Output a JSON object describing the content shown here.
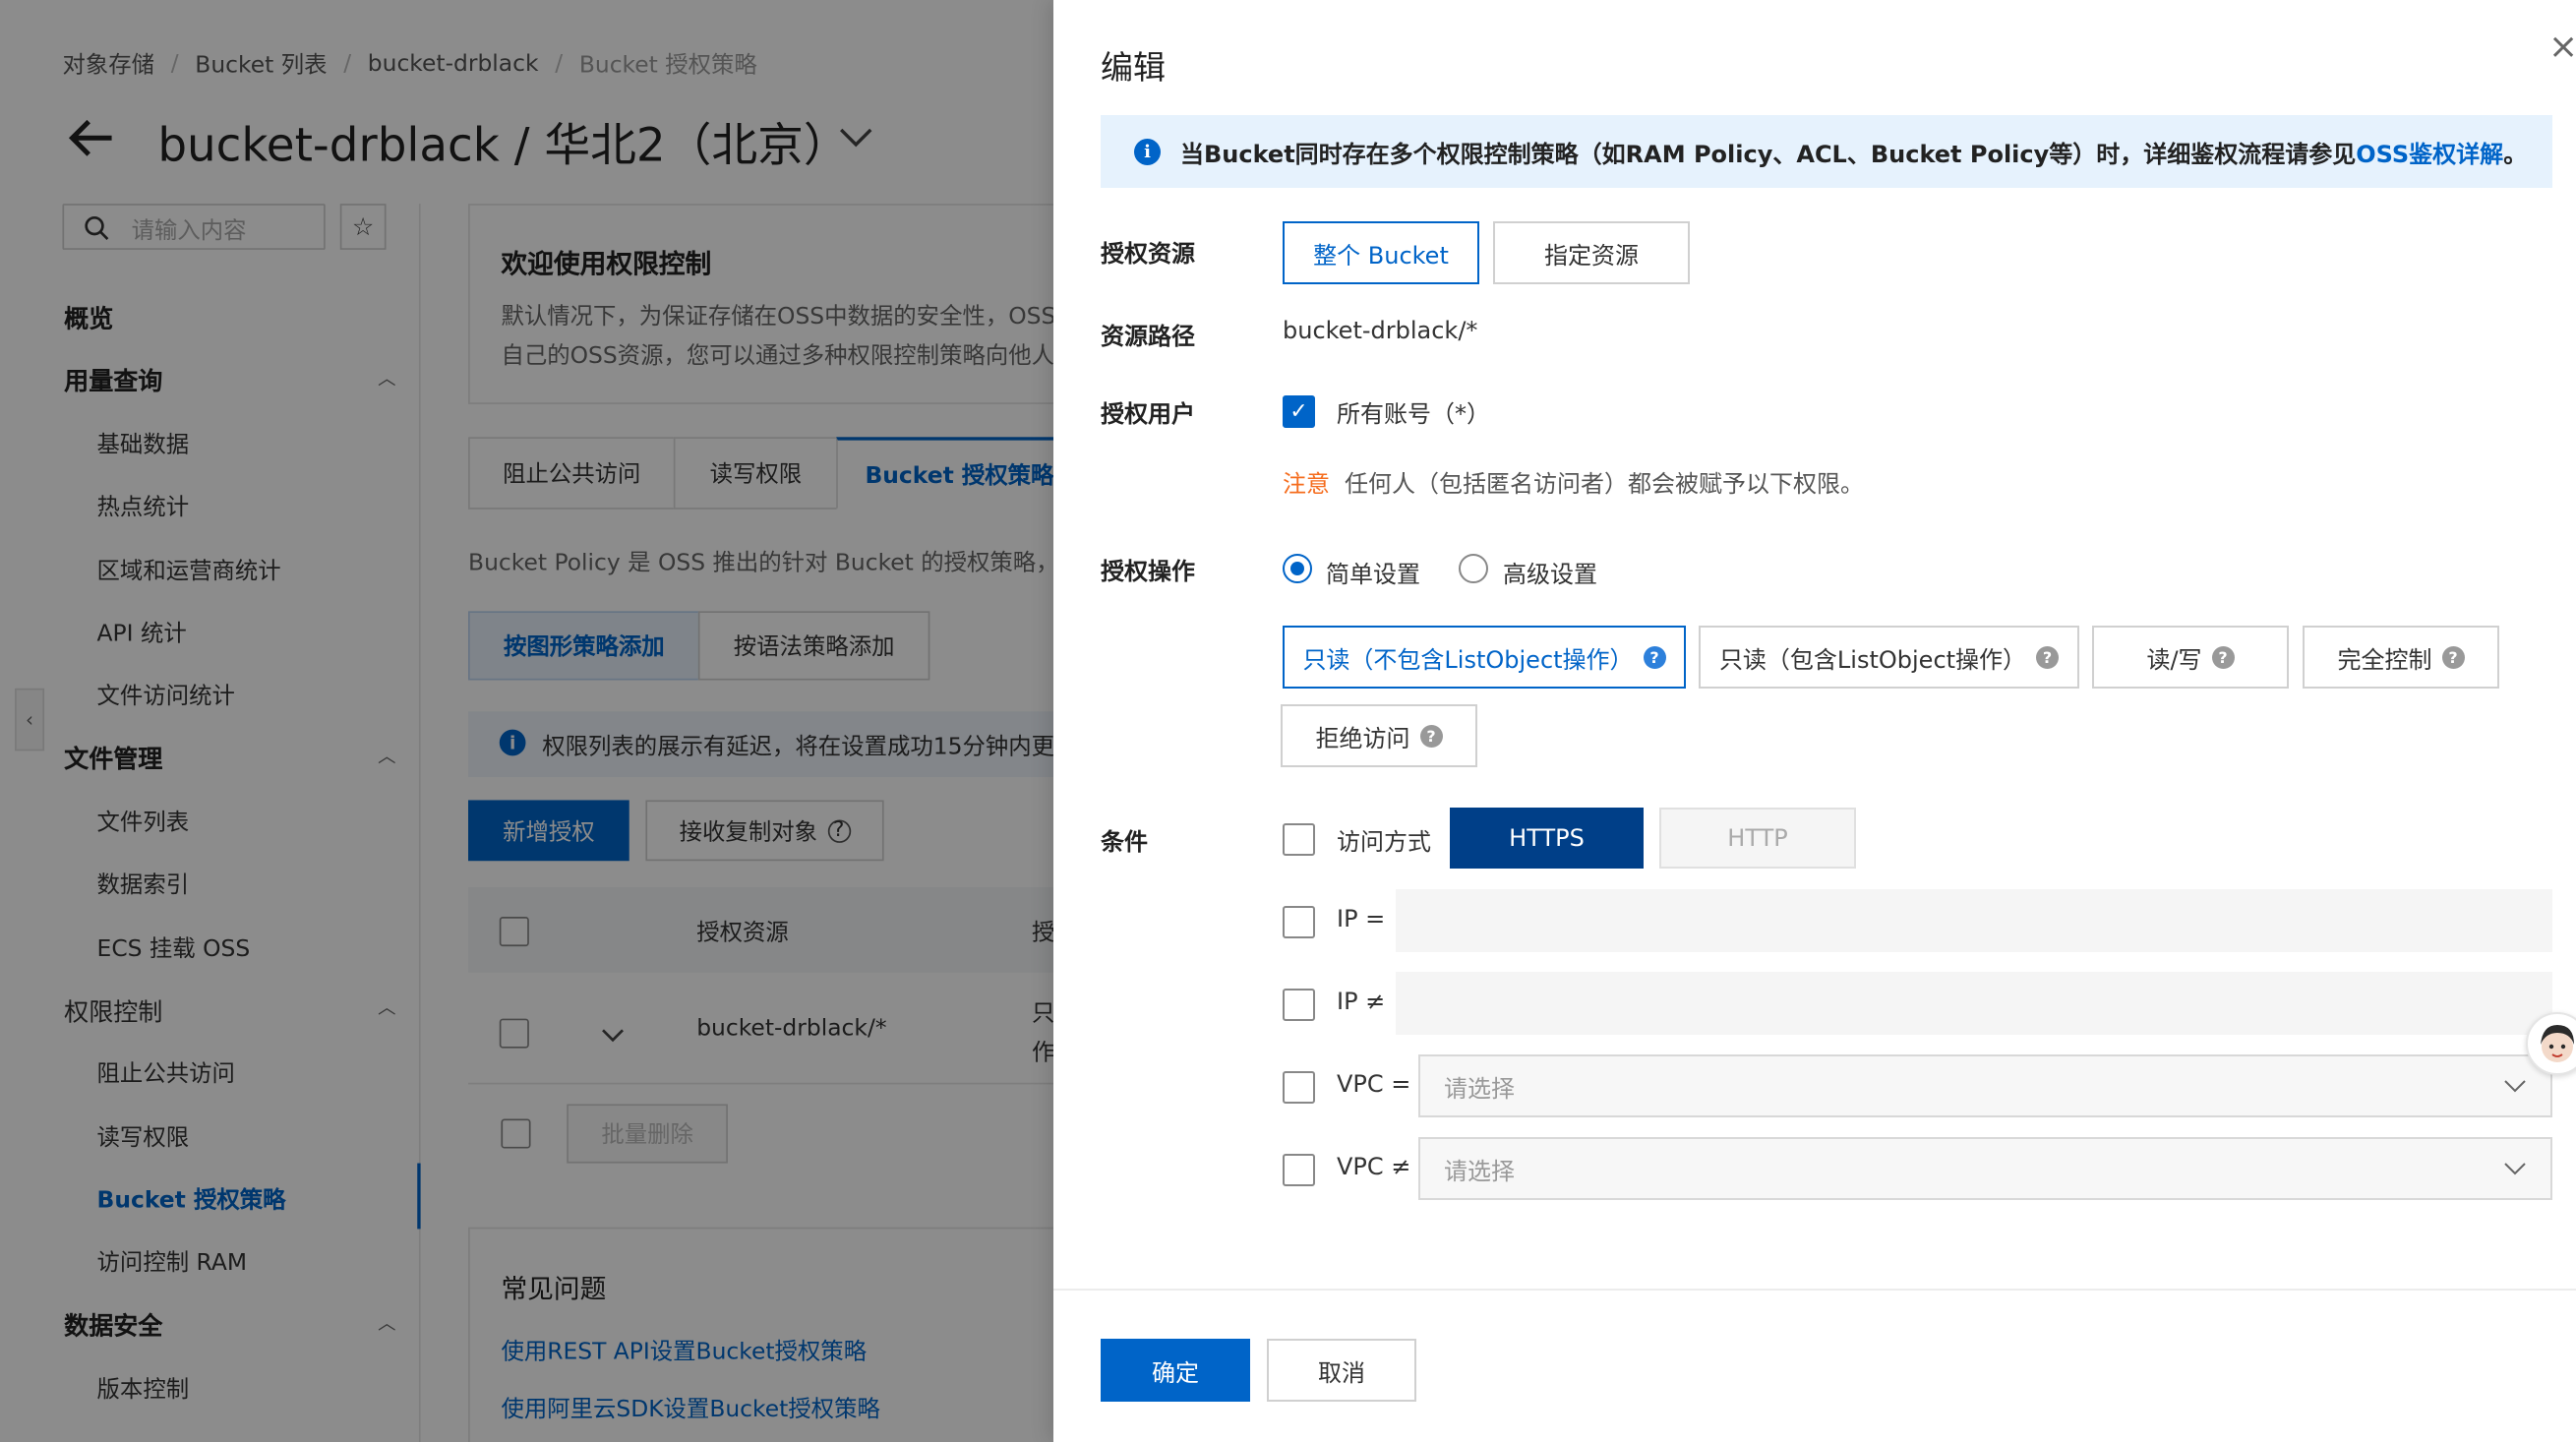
{
  "breadcrumb": [
    "对象存储",
    "Bucket 列表",
    "bucket-drblack",
    "Bucket 授权策略"
  ],
  "page": {
    "title": "bucket-drblack / 华北2（北京）",
    "back_icon": "arrow-left-icon",
    "dropdown_icon": "chevron-down-icon"
  },
  "sidebar": {
    "search_placeholder": "请输入内容",
    "overview": "概览",
    "groups": [
      {
        "label": "用量查询",
        "items": [
          "基础数据",
          "热点统计",
          "区域和运营商统计",
          "API 统计",
          "文件访问统计"
        ]
      },
      {
        "label": "文件管理",
        "items": [
          "文件列表",
          "数据索引",
          "ECS 挂载 OSS"
        ]
      },
      {
        "label": "权限控制",
        "items": [
          "阻止公共访问",
          "读写权限",
          "Bucket 授权策略",
          "访问控制 RAM"
        ]
      },
      {
        "label": "数据安全",
        "items": [
          "版本控制"
        ]
      }
    ]
  },
  "welcome": {
    "title": "欢迎使用权限控制",
    "line1": "默认情况下，为保证存储在OSS中数据的安全性，OSS",
    "line2": "自己的OSS资源，您可以通过多种权限控制策略向他人"
  },
  "tabs": [
    "阻止公共访问",
    "读写权限",
    "Bucket 授权策略"
  ],
  "policy_desc": "Bucket Policy 是 OSS 推出的针对 Bucket 的授权策略，您",
  "add_modes": [
    "按图形策略添加",
    "按语法策略添加"
  ],
  "delay_note": "权限列表的展示有延迟，将在设置成功15分钟内更",
  "actions": {
    "add": "新增授权",
    "receive": "接收复制对象"
  },
  "table": {
    "header": [
      "授权资源",
      "授"
    ],
    "row": {
      "resource": "bucket-drblack/*",
      "cut1": "只",
      "cut2": "作"
    },
    "batch_delete": "批量删除"
  },
  "faq": {
    "title": "常见问题",
    "links": [
      "使用REST API设置Bucket授权策略",
      "使用阿里云SDK设置Bucket授权策略"
    ]
  },
  "drawer": {
    "title": "编辑",
    "alert_text": "当Bucket同时存在多个权限控制策略（如RAM Policy、ACL、Bucket Policy等）时，详细鉴权流程请参见",
    "alert_link": "OSS鉴权详解",
    "alert_end": "。",
    "resource_label": "授权资源",
    "resource_options": [
      "整个 Bucket",
      "指定资源"
    ],
    "path_label": "资源路径",
    "path_value": "bucket-drblack/*",
    "user_label": "授权用户",
    "user_option": "所有账号（*）",
    "warn_label": "注意",
    "warn_text": "任何人（包括匿名访问者）都会被赋予以下权限。",
    "op_label": "授权操作",
    "op_modes": [
      "简单设置",
      "高级设置"
    ],
    "perm_options": [
      "只读（不包含ListObject操作）",
      "只读（包含ListObject操作）",
      "读/写",
      "完全控制",
      "拒绝访问"
    ],
    "cond_label": "条件",
    "access_label": "访问方式",
    "protocols": [
      "HTTPS",
      "HTTP"
    ],
    "ip_eq": "IP =",
    "ip_ne": "IP ≠",
    "vpc_eq": "VPC =",
    "vpc_ne": "VPC ≠",
    "select_placeholder": "请选择",
    "ok": "确定",
    "cancel": "取消"
  },
  "colors": {
    "brand": "#0064c8",
    "dark_brand": "#003f88",
    "warning": "#f56c1d"
  }
}
